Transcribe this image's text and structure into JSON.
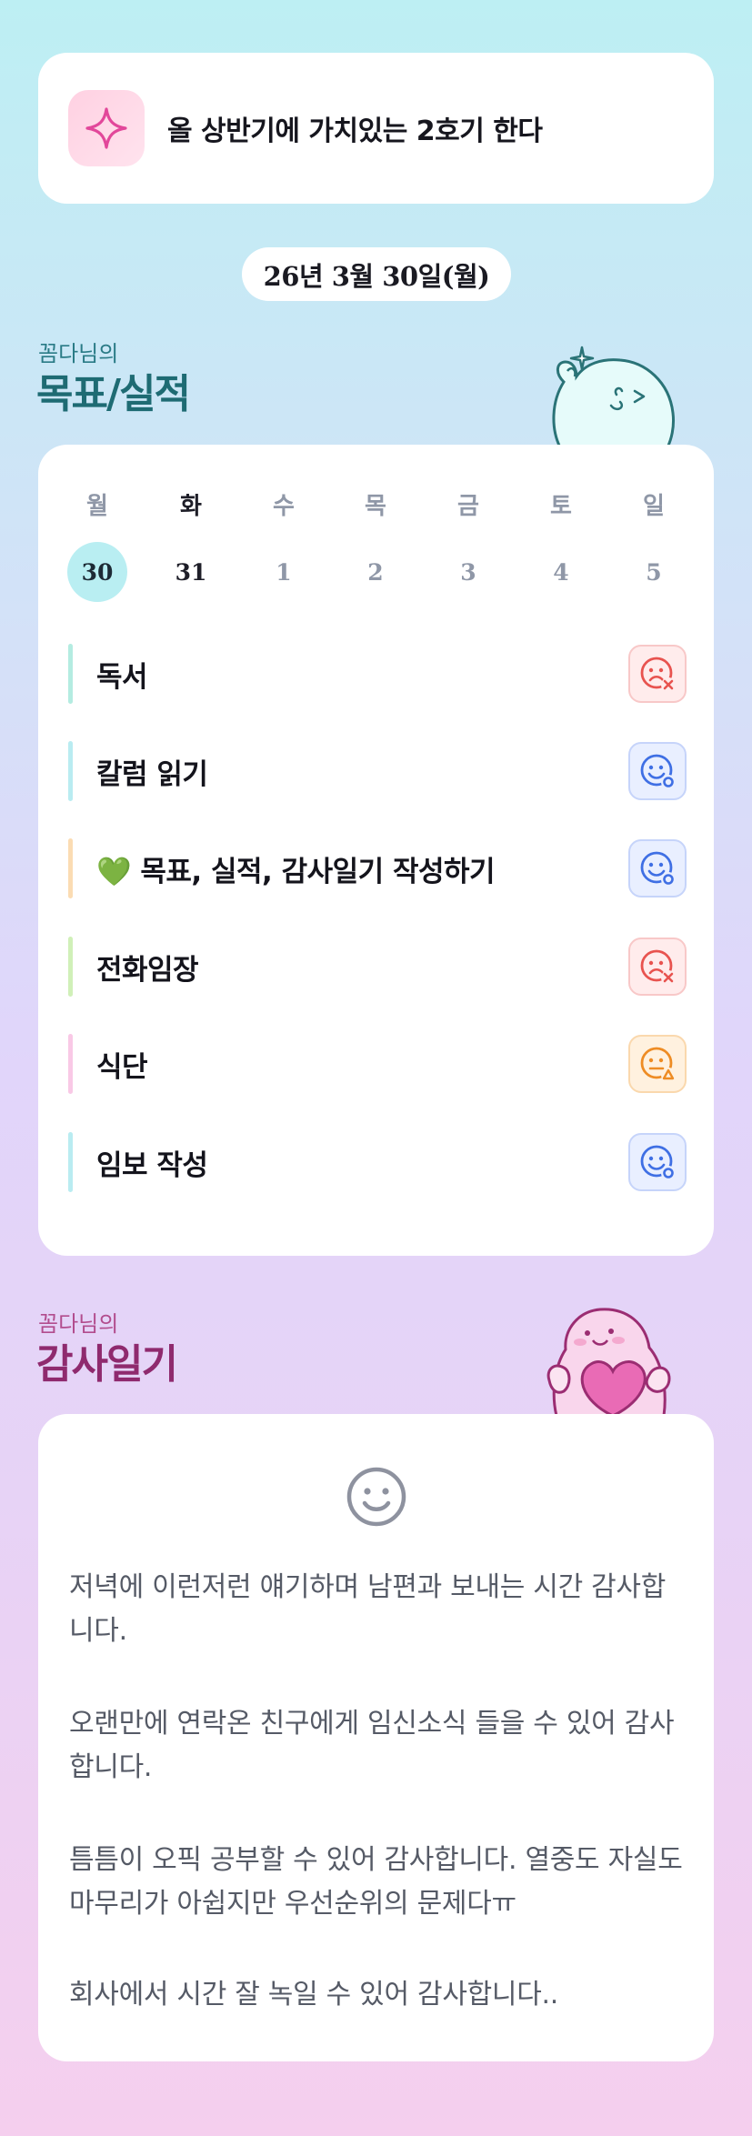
{
  "goal": {
    "text": "올 상반기에 가치있는 2호기 한다",
    "icon": "sparkle-icon"
  },
  "date": "26년 3월 30일(월)",
  "goals_section": {
    "subtitle": "꼼다님의",
    "title": "목표/실적"
  },
  "calendar": {
    "weekdays": [
      "월",
      "화",
      "수",
      "목",
      "금",
      "토",
      "일"
    ],
    "days": [
      "30",
      "31",
      "1",
      "2",
      "3",
      "4",
      "5"
    ]
  },
  "tasks": [
    {
      "label": "독서",
      "bar_color": "#b4ece1",
      "status": "bad"
    },
    {
      "label": "칼럼 읽기",
      "bar_color": "#b9ecf1",
      "status": "good"
    },
    {
      "label": "💚 목표, 실적, 감사일기 작성하기",
      "bar_color": "#fbdcb3",
      "status": "good"
    },
    {
      "label": "전화임장",
      "bar_color": "#d0f0b8",
      "status": "bad"
    },
    {
      "label": "식단",
      "bar_color": "#f9c9e6",
      "status": "mid"
    },
    {
      "label": "임보 작성",
      "bar_color": "#b9ecf1",
      "status": "good"
    }
  ],
  "gratitude_section": {
    "subtitle": "꼼다님의",
    "title": "감사일기"
  },
  "gratitude": {
    "icon": "smile-icon",
    "entries": [
      "저녁에 이런저런 얘기하며 남편과 보내는 시간 감사합니다.",
      "오랜만에 연락온 친구에게 임신소식 들을 수 있어 감사합니다.",
      "틈틈이 오픽 공부할 수 있어 감사합니다. 열중도 자실도 마무리가 아쉽지만 우선순위의 문제다ㅠ",
      "회사에서 시간 잘 녹일 수 있어 감사합니다.."
    ]
  },
  "colors": {
    "teal": "#1e6b73",
    "pink": "#8f2a6e",
    "bad": "#e8534f",
    "good": "#3f6fe4",
    "mid": "#ee8c24"
  }
}
